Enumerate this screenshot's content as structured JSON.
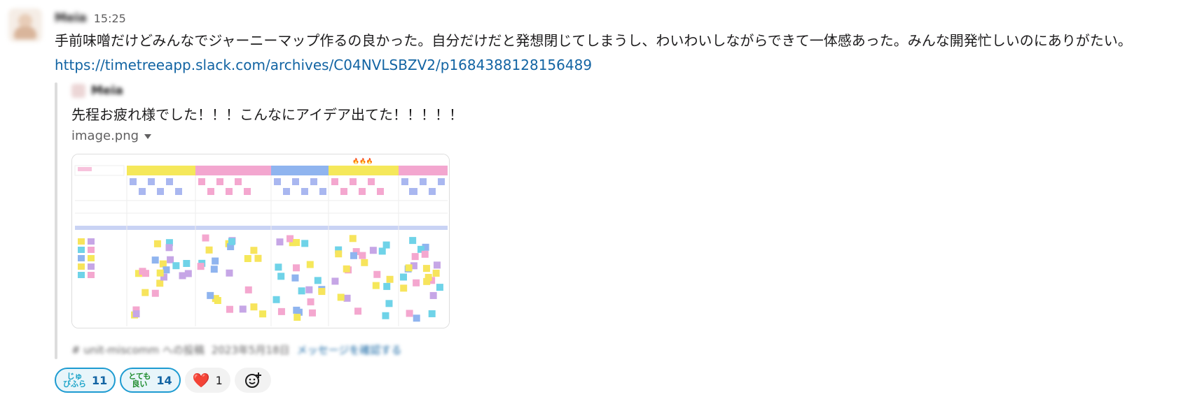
{
  "message": {
    "sender": "Meia",
    "time": "15:25",
    "text": "手前味噌だけどみんなでジャーニーマップ作るの良かった。自分だけだと発想閉じてしまうし、わいわいしながらできて一体感あった。みんな開発忙しいのにありがたい。",
    "link": "https://timetreeapp.slack.com/archives/C04NVLSBZV2/p1684388128156489"
  },
  "quote": {
    "author": "Meia",
    "text": "先程お疲れ様でした！！！こんなにアイデア出てた！！！！！",
    "file_name": "image.png",
    "footer_channel": "# unit-miscomm への投稿",
    "footer_date": "2023年5月18日",
    "footer_link": "メッセージを確認する"
  },
  "reactions": [
    {
      "emoji_line1": "じゅ",
      "emoji_line2": "びふら",
      "count": "11",
      "active": true,
      "icon": "juubifura-emoji"
    },
    {
      "emoji_line1": "とても",
      "emoji_line2": "良い",
      "count": "14",
      "active": true,
      "icon": "totemo-yoi-emoji"
    },
    {
      "emoji": "❤️",
      "count": "1",
      "active": false,
      "icon": "heart-icon"
    }
  ],
  "colors": {
    "link": "#1264a3",
    "active_reaction_border": "#1d9bd1",
    "active_reaction_bg": "#e8f5fa",
    "quote_bar": "#dddddd"
  }
}
